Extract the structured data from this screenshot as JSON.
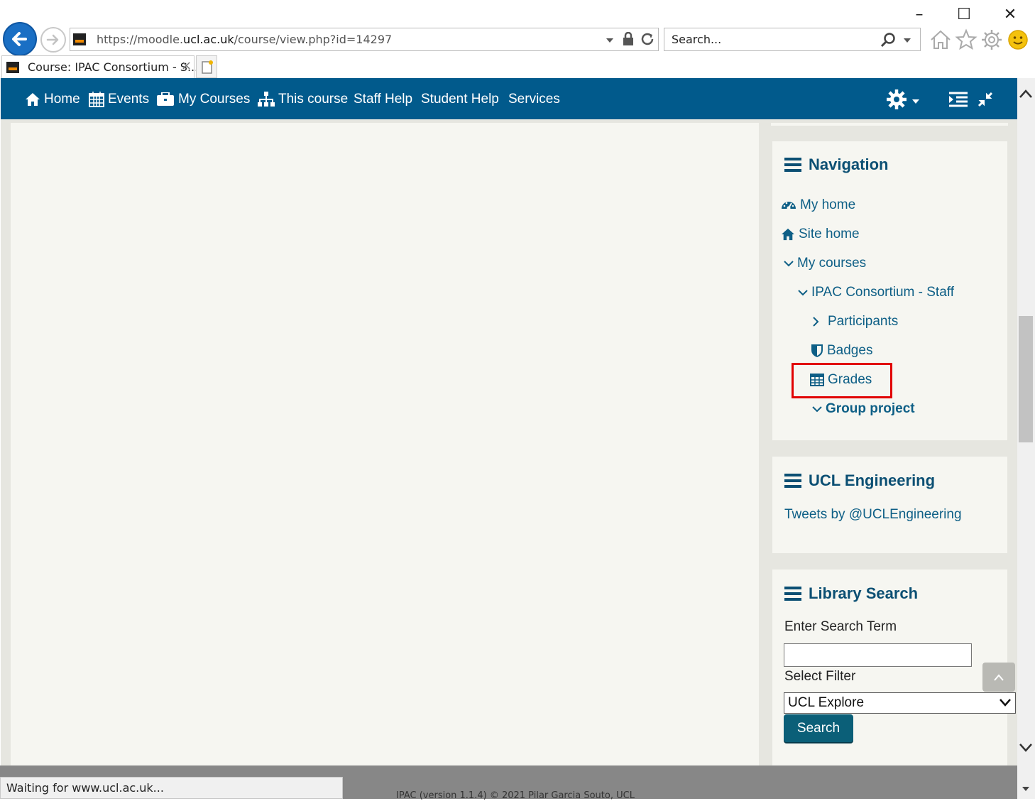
{
  "browser": {
    "url_prefix": "https://moodle.",
    "url_domain": "ucl.ac.uk",
    "url_path": "/course/view.php?id=14297",
    "search_placeholder": "Search...",
    "tab_title": "Course: IPAC Consortium - S...",
    "tab_close": "×",
    "window_controls": {
      "minimize": "–",
      "maximize": "☐",
      "close": "✕"
    },
    "icons": [
      "back-arrow-icon",
      "forward-arrow-icon",
      "lock-icon",
      "refresh-icon",
      "search-icon",
      "home-icon",
      "star-icon",
      "gear-icon",
      "smiley-icon"
    ]
  },
  "navbar": {
    "items": [
      {
        "label": "Home",
        "icon": "home-icon"
      },
      {
        "label": "Events",
        "icon": "calendar-icon"
      },
      {
        "label": "My Courses",
        "icon": "briefcase-icon"
      },
      {
        "label": "This course",
        "icon": "sitemap-icon"
      },
      {
        "label": "Staff Help"
      },
      {
        "label": "Student Help"
      },
      {
        "label": "Services"
      }
    ],
    "right_icons": [
      "settings-gear-icon",
      "sidebar-toggle-icon",
      "collapse-icon"
    ]
  },
  "navigation_block": {
    "title": "Navigation",
    "items": [
      {
        "label": "My home",
        "icon": "dashboard-icon"
      },
      {
        "label": "Site home",
        "icon": "home-icon"
      },
      {
        "label": "My courses",
        "icon": "chevron-down-icon"
      },
      {
        "label": "IPAC Consortium - Staff",
        "icon": "chevron-down-icon"
      },
      {
        "label": "Participants",
        "icon": "chevron-right-icon"
      },
      {
        "label": "Badges",
        "icon": "shield-icon"
      },
      {
        "label": "Grades",
        "icon": "table-icon",
        "highlighted": true
      },
      {
        "label": "Group project",
        "icon": "chevron-down-icon"
      }
    ]
  },
  "engineering_block": {
    "title": "UCL Engineering",
    "link": "Tweets by @UCLEngineering"
  },
  "library_block": {
    "title": "Library Search",
    "term_label": "Enter Search Term",
    "term_value": "",
    "filter_label": "Select Filter",
    "filter_value": "UCL Explore",
    "search_button": "Search"
  },
  "footer": {
    "text": "IPAC (version 1.1.4) © 2021 Pilar Garcia Souto, UCL"
  },
  "status": {
    "text": "Waiting for www.ucl.ac.uk..."
  },
  "colors": {
    "navbar": "#015a8c",
    "link": "#0e5f86",
    "block_title": "#0b4f73",
    "highlight": "#e10000",
    "button": "#0b5f78"
  }
}
